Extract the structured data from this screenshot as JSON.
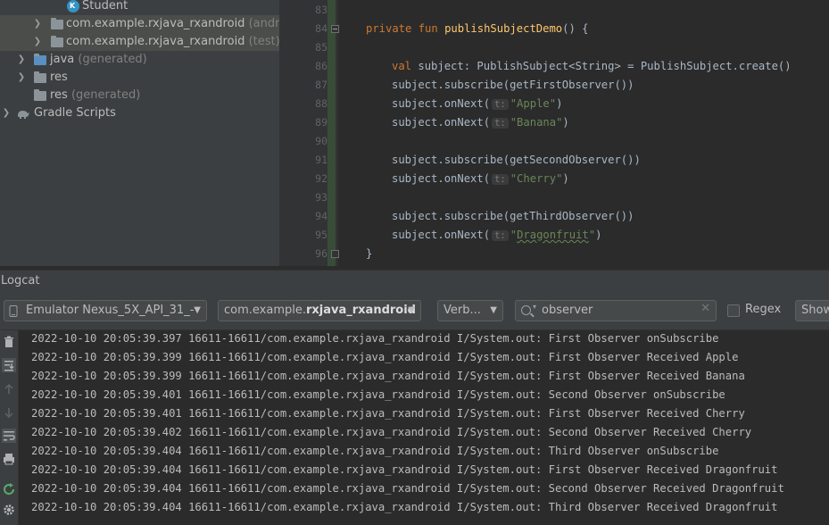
{
  "project_tree": {
    "items": [
      {
        "label": "Student",
        "suffix": ""
      },
      {
        "label": "com.example.rxjava_rxandroid",
        "suffix": "(androidTest)"
      },
      {
        "label": "com.example.rxjava_rxandroid",
        "suffix": "(test)"
      },
      {
        "label": "java",
        "suffix": "(generated)"
      },
      {
        "label": "res",
        "suffix": ""
      },
      {
        "label": "res",
        "suffix": "(generated)"
      },
      {
        "label": "Gradle Scripts",
        "suffix": ""
      }
    ]
  },
  "editor": {
    "line_numbers": [
      "83",
      "84",
      "85",
      "86",
      "87",
      "88",
      "89",
      "90",
      "91",
      "92",
      "93",
      "94",
      "95",
      "96"
    ],
    "code": {
      "l84_kw": "private fun ",
      "l84_fn": "publishSubjectDemo",
      "l84_rest": "() {",
      "l86_kw": "val ",
      "l86_rest": "subject: PublishSubject<String> = PublishSubject.create()",
      "l87": "subject.subscribe(getFirstObserver())",
      "l88_pre": "subject.onNext(",
      "l88_str": "\"Apple\"",
      "l88_post": ")",
      "l89_pre": "subject.onNext(",
      "l89_str": "\"Banana\"",
      "l89_post": ")",
      "l91": "subject.subscribe(getSecondObserver())",
      "l92_pre": "subject.onNext(",
      "l92_str": "\"Cherry\"",
      "l92_post": ")",
      "l94": "subject.subscribe(getThirdObserver())",
      "l95_pre": "subject.onNext(",
      "l95_str_q1": "\"",
      "l95_str_word": "Dragonfruit",
      "l95_str_q2": "\"",
      "l95_post": ")",
      "l96": "}",
      "param_hint": "t:"
    }
  },
  "logcat": {
    "title": "Logcat",
    "device": "Emulator Nexus_5X_API_31_-",
    "package_prefix": "com.example.",
    "package_bold": "rxjava_rxandroid",
    "level": "Verb...",
    "search_value": "observer",
    "clear_glyph": "✕",
    "regex_label": "Regex",
    "show_label": "Show",
    "lines": [
      "2022-10-10 20:05:39.397 16611-16611/com.example.rxjava_rxandroid I/System.out: First Observer onSubscribe",
      "2022-10-10 20:05:39.399 16611-16611/com.example.rxjava_rxandroid I/System.out: First Observer Received Apple",
      "2022-10-10 20:05:39.399 16611-16611/com.example.rxjava_rxandroid I/System.out: First Observer Received Banana",
      "2022-10-10 20:05:39.401 16611-16611/com.example.rxjava_rxandroid I/System.out: Second Observer onSubscribe",
      "2022-10-10 20:05:39.401 16611-16611/com.example.rxjava_rxandroid I/System.out: First Observer Received Cherry",
      "2022-10-10 20:05:39.402 16611-16611/com.example.rxjava_rxandroid I/System.out: Second Observer Received Cherry",
      "2022-10-10 20:05:39.404 16611-16611/com.example.rxjava_rxandroid I/System.out: Third Observer onSubscribe",
      "2022-10-10 20:05:39.404 16611-16611/com.example.rxjava_rxandroid I/System.out: First Observer Received Dragonfruit",
      "2022-10-10 20:05:39.404 16611-16611/com.example.rxjava_rxandroid I/System.out: Second Observer Received Dragonfruit",
      "2022-10-10 20:05:39.404 16611-16611/com.example.rxjava_rxandroid I/System.out: Third Observer Received Dragonfruit"
    ]
  },
  "colors": {
    "keyword": "#cc7832",
    "function": "#ffc66d",
    "string": "#6a8759",
    "text": "#a9b7c6"
  }
}
